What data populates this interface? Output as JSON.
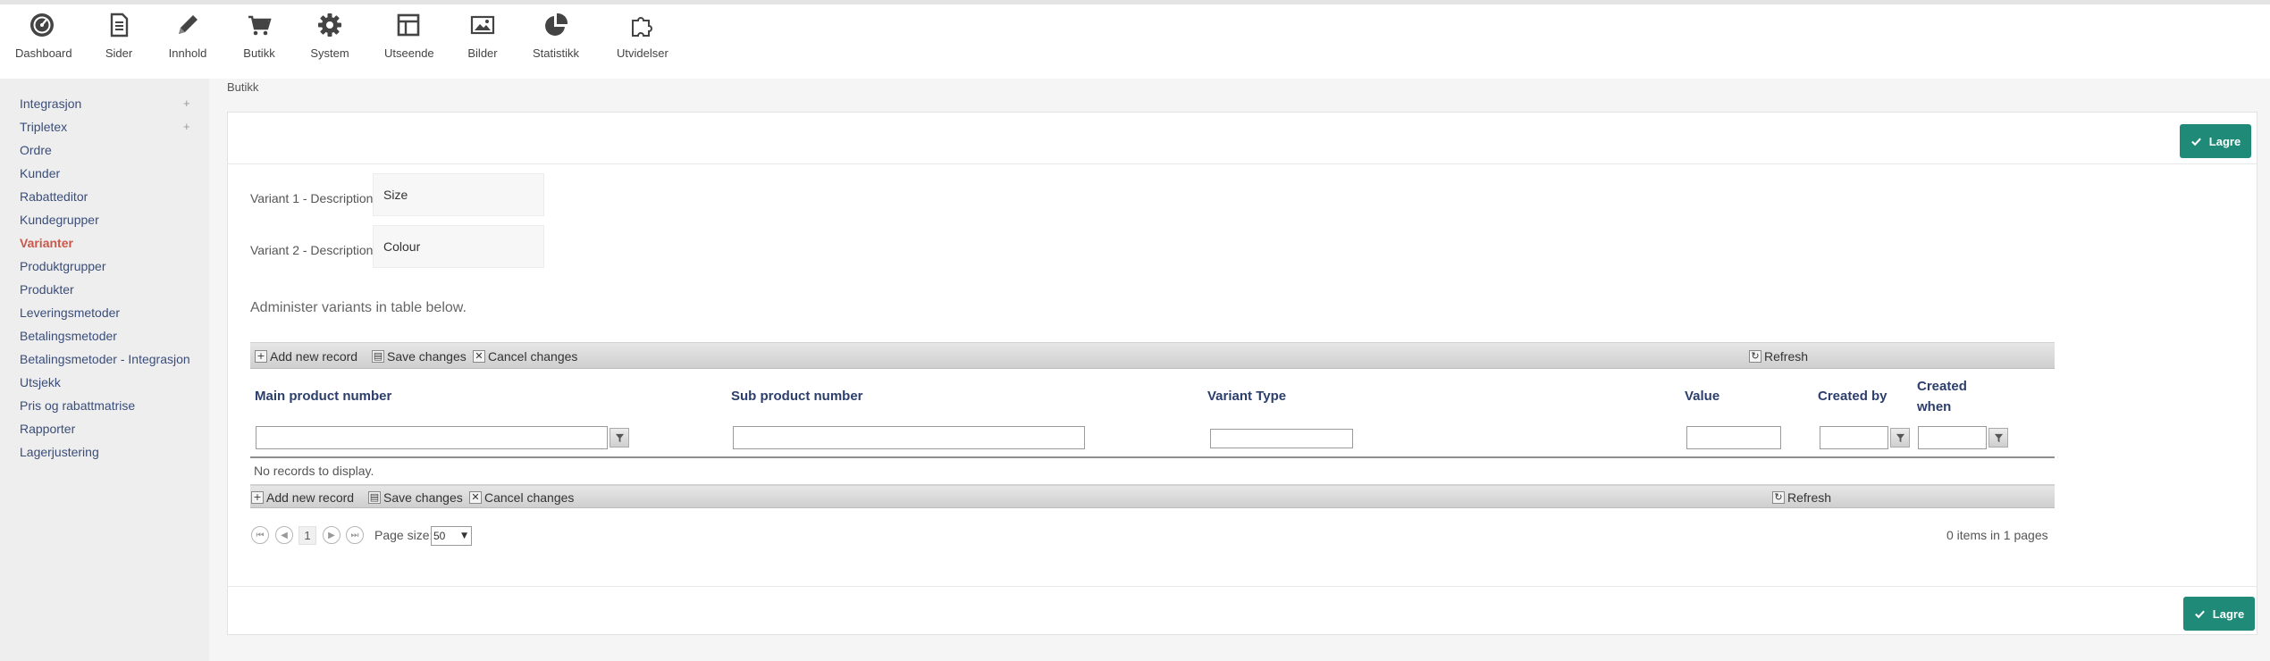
{
  "topnav": {
    "items": [
      {
        "label": "Dashboard",
        "icon": "dashboard-icon"
      },
      {
        "label": "Sider",
        "icon": "document-icon"
      },
      {
        "label": "Innhold",
        "icon": "pencil-icon"
      },
      {
        "label": "Butikk",
        "icon": "cart-icon"
      },
      {
        "label": "System",
        "icon": "gear-icon"
      },
      {
        "label": "Utseende",
        "icon": "layout-icon"
      },
      {
        "label": "Bilder",
        "icon": "image-icon"
      },
      {
        "label": "Statistikk",
        "icon": "pie-chart-icon"
      },
      {
        "label": "Utvidelser",
        "icon": "puzzle-icon"
      }
    ]
  },
  "sidebar": {
    "items": [
      {
        "label": "Integrasjon",
        "expandable": true
      },
      {
        "label": "Tripletex",
        "expandable": true
      },
      {
        "label": "Ordre"
      },
      {
        "label": "Kunder"
      },
      {
        "label": "Rabatteditor"
      },
      {
        "label": "Kundegrupper"
      },
      {
        "label": "Varianter",
        "active": true
      },
      {
        "label": "Produktgrupper"
      },
      {
        "label": "Produkter"
      },
      {
        "label": "Leveringsmetoder"
      },
      {
        "label": "Betalingsmetoder"
      },
      {
        "label": "Betalingsmetoder - Integrasjon"
      },
      {
        "label": "Utsjekk"
      },
      {
        "label": "Pris og rabattmatrise"
      },
      {
        "label": "Rapporter"
      },
      {
        "label": "Lagerjustering"
      }
    ],
    "plus_symbol": "+"
  },
  "breadcrumb": "Butikk",
  "save_label": "Lagre",
  "form": {
    "variant1_label": "Variant 1 - Description",
    "variant1_value": "Size",
    "variant2_label": "Variant 2 - Description",
    "variant2_value": "Colour"
  },
  "note": "Administer variants in table below.",
  "grid": {
    "toolbar": {
      "add": "Add new record",
      "save": "Save changes",
      "cancel": "Cancel changes",
      "refresh": "Refresh"
    },
    "columns": {
      "main_product": "Main product number",
      "sub_product": "Sub product number",
      "variant_type": "Variant Type",
      "value": "Value",
      "created_by": "Created by",
      "created_when_1": "Created",
      "created_when_2": "when"
    },
    "no_records": "No records to display.",
    "pager": {
      "current_page": "1",
      "page_size_label": "Page size:",
      "page_size": "50",
      "info": "0 items in 1 pages"
    }
  },
  "colors": {
    "accent": "#1f8a78",
    "active_sidebar": "#c8584b",
    "link": "#3a4d7a"
  }
}
